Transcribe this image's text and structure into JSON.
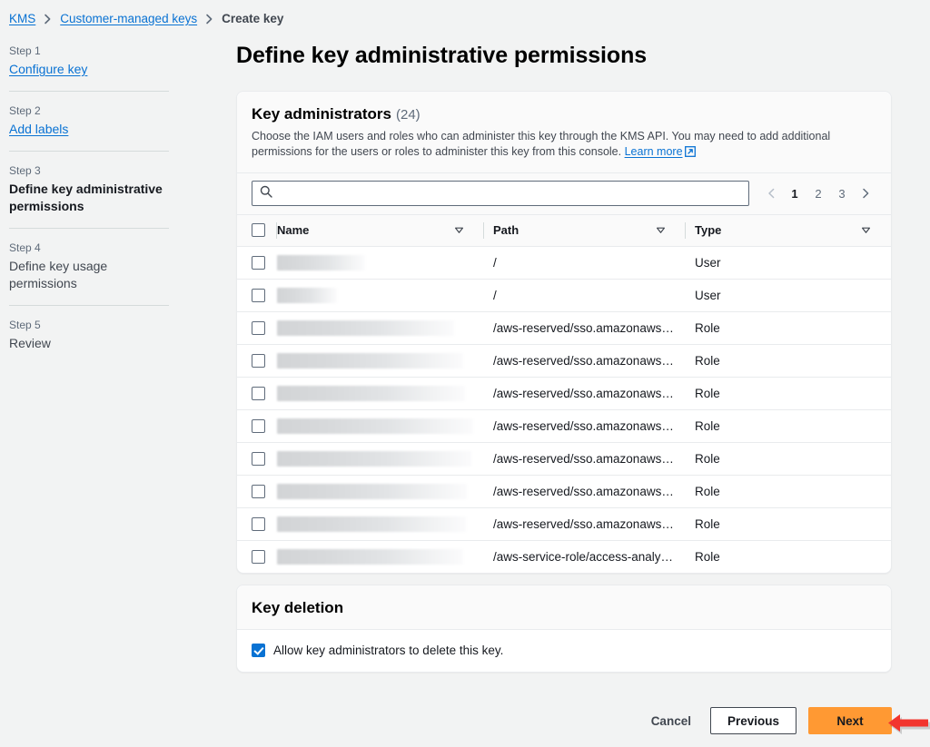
{
  "breadcrumb": {
    "items": [
      {
        "label": "KMS",
        "type": "link"
      },
      {
        "label": "Customer-managed keys",
        "type": "link"
      },
      {
        "label": "Create key",
        "type": "current"
      }
    ]
  },
  "wizard": {
    "steps": [
      {
        "num": "Step 1",
        "label": "Configure key",
        "state": "link"
      },
      {
        "num": "Step 2",
        "label": "Add labels",
        "state": "link"
      },
      {
        "num": "Step 3",
        "label": "Define key administrative permissions",
        "state": "active"
      },
      {
        "num": "Step 4",
        "label": "Define key usage permissions",
        "state": "inactive"
      },
      {
        "num": "Step 5",
        "label": "Review",
        "state": "inactive"
      }
    ]
  },
  "page": {
    "title": "Define key administrative permissions"
  },
  "admins_card": {
    "title": "Key administrators",
    "count": "(24)",
    "description": "Choose the IAM users and roles who can administer this key through the KMS API. You may need to add additional permissions for the users or roles to administer this key from this console.",
    "learn_more": "Learn more",
    "search": {
      "placeholder": "",
      "value": "",
      "icon": "search-icon"
    },
    "pagination": {
      "prev_icon": "chevron-left-icon",
      "next_icon": "chevron-right-icon",
      "pages": [
        "1",
        "2",
        "3"
      ],
      "current": "1"
    },
    "table": {
      "columns": [
        "Name",
        "Path",
        "Type"
      ],
      "sort_icon": "sort-descending-triangle-icon",
      "rows": [
        {
          "name": "",
          "name_redacted_width": 97,
          "path": "/",
          "type": "User"
        },
        {
          "name": "",
          "name_redacted_width": 66,
          "path": "/",
          "type": "User"
        },
        {
          "name": "",
          "name_redacted_width": 195,
          "path": "/aws-reserved/sso.amazonaws…",
          "type": "Role"
        },
        {
          "name": "",
          "name_redacted_width": 205,
          "path": "/aws-reserved/sso.amazonaws…",
          "type": "Role"
        },
        {
          "name": "",
          "name_redacted_width": 207,
          "path": "/aws-reserved/sso.amazonaws…",
          "type": "Role"
        },
        {
          "name": "",
          "name_redacted_width": 216,
          "path": "/aws-reserved/sso.amazonaws…",
          "type": "Role"
        },
        {
          "name": "",
          "name_redacted_width": 214,
          "path": "/aws-reserved/sso.amazonaws…",
          "type": "Role"
        },
        {
          "name": "",
          "name_redacted_width": 209,
          "path": "/aws-reserved/sso.amazonaws…",
          "type": "Role"
        },
        {
          "name": "",
          "name_redacted_width": 208,
          "path": "/aws-reserved/sso.amazonaws…",
          "type": "Role"
        },
        {
          "name": "",
          "name_redacted_width": 205,
          "path": "/aws-service-role/access-analy…",
          "type": "Role"
        }
      ]
    }
  },
  "deletion_card": {
    "title": "Key deletion",
    "checkbox_label": "Allow key administrators to delete this key.",
    "checked": true
  },
  "footer": {
    "cancel": "Cancel",
    "previous": "Previous",
    "next": "Next"
  },
  "annotation": {
    "arrow": "left-pointing-arrow-annotation",
    "color": "#f2352e"
  },
  "colors": {
    "page_bg": "#f2f3f3",
    "link": "#0972d3",
    "primary_button": "#ff9933",
    "checkbox_checked": "#0972d3",
    "annotation_red": "#f2352e"
  }
}
